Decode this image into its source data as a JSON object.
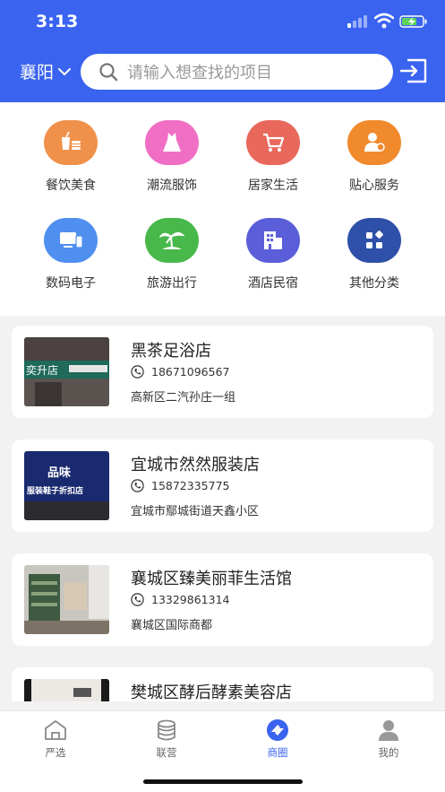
{
  "status_bar": {
    "time": "3:13"
  },
  "header": {
    "city": "襄阳",
    "search_placeholder": "请输入想查找的项目"
  },
  "categories": [
    {
      "label": "餐饮美食",
      "icon": "food-drink-icon",
      "color": "#f0914b"
    },
    {
      "label": "潮流服饰",
      "icon": "dress-icon",
      "color": "#f06fc5"
    },
    {
      "label": "居家生活",
      "icon": "shopping-cart-icon",
      "color": "#e8685c"
    },
    {
      "label": "贴心服务",
      "icon": "service-person-icon",
      "color": "#f08a2c"
    },
    {
      "label": "数码电子",
      "icon": "devices-icon",
      "color": "#4f8ff0"
    },
    {
      "label": "旅游出行",
      "icon": "palm-island-icon",
      "color": "#48b84a"
    },
    {
      "label": "酒店民宿",
      "icon": "hotel-building-icon",
      "color": "#5a5ed9"
    },
    {
      "label": "其他分类",
      "icon": "grid-icon",
      "color": "#2e50a8"
    }
  ],
  "shops": [
    {
      "name": "黑茶足浴店",
      "phone": "18671096567",
      "address": "高新区二汽孙庄一组"
    },
    {
      "name": "宜城市然然服装店",
      "phone": "15872335775",
      "address": "宜城市鄢城街道天鑫小区"
    },
    {
      "name": "襄城区臻美丽菲生活馆",
      "phone": "13329861314",
      "address": "襄城区国际商都"
    },
    {
      "name": "樊城区酵后酵素美容店",
      "phone": "",
      "address": ""
    }
  ],
  "thumbnails": {
    "shop1_sign": "奕升店",
    "shop2_sign_top": "品味",
    "shop2_sign_bottom": "服装鞋子折扣店"
  },
  "tabbar": [
    {
      "label": "严选",
      "icon": "shop-house-icon",
      "active": false
    },
    {
      "label": "联营",
      "icon": "coins-stack-icon",
      "active": false
    },
    {
      "label": "商圈",
      "icon": "business-circle-icon",
      "active": true
    },
    {
      "label": "我的",
      "icon": "user-icon",
      "active": false
    }
  ],
  "colors": {
    "primary": "#3a63f0",
    "background": "#f2f2f2"
  }
}
